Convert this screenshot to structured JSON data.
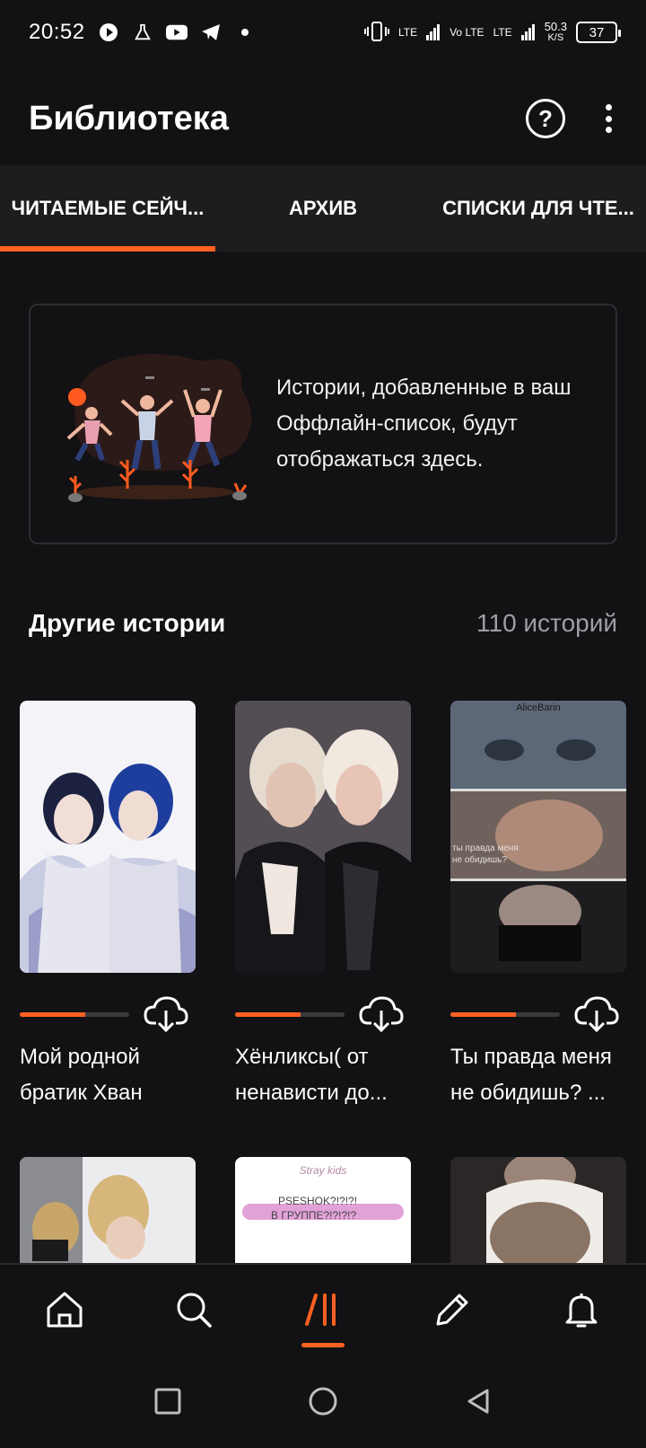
{
  "status_bar": {
    "time": "20:52",
    "net_lte1": "LTE",
    "net_volte": "Vo LTE",
    "net_lte2": "LTE",
    "speed_value": "50.3",
    "speed_unit": "K/S",
    "battery": "37"
  },
  "header": {
    "title": "Библиотека",
    "help_glyph": "?"
  },
  "tabs": [
    {
      "label": "ЧИТАЕМЫЕ СЕЙЧ...",
      "active": true
    },
    {
      "label": "АРХИВ",
      "active": false
    },
    {
      "label": "СПИСКИ ДЛЯ ЧТЕ...",
      "active": false
    }
  ],
  "offline_card": {
    "text": "Истории, добавленные в ваш Оффлайн-список, будут отображаться здесь."
  },
  "other_stories": {
    "title": "Другие истории",
    "count": "110 историй"
  },
  "stories": [
    {
      "title": "Мой родной братик Хван",
      "progress": 0.6
    },
    {
      "title": "Хёнликсы( от ненависти до...",
      "progress": 0.6
    },
    {
      "title": "Ты правда меня не обидишь? ...",
      "progress": 0.6
    }
  ],
  "cover_texts": {
    "cover3_watermark": "AliceBarin",
    "cover3_caption": "ты правда меня не обидишь?",
    "cover5_top": "Stray kids",
    "cover5_line1": "PSESHOK?!?!?!",
    "cover5_line2": "В ГРУППЕ?!?!?!?"
  },
  "colors": {
    "accent": "#ff6122",
    "background": "#121113",
    "tab_bar": "#1d1c1f"
  },
  "bottom_nav": [
    {
      "name": "home-icon"
    },
    {
      "name": "search-icon"
    },
    {
      "name": "library-icon",
      "active": true
    },
    {
      "name": "write-icon"
    },
    {
      "name": "notifications-icon"
    }
  ]
}
